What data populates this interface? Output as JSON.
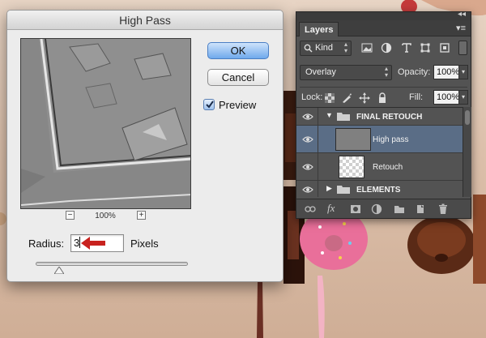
{
  "dialog": {
    "title": "High Pass",
    "ok_label": "OK",
    "cancel_label": "Cancel",
    "preview_label": "Preview",
    "preview_checked": true,
    "zoom_level": "100%",
    "radius_label": "Radius:",
    "radius_value": "3",
    "radius_units": "Pixels",
    "radius_slider_value": 3
  },
  "layers_panel": {
    "tab_label": "Layers",
    "filter_kind": "Kind",
    "blend_mode": "Overlay",
    "opacity_label": "Opacity:",
    "opacity_value": "100%",
    "lock_label": "Lock:",
    "fill_label": "Fill:",
    "fill_value": "100%",
    "layers": [
      {
        "name": "FINAL RETOUCH",
        "type": "group",
        "expanded": true,
        "visible": true
      },
      {
        "name": "High pass",
        "type": "layer",
        "selected": true,
        "visible": true,
        "thumbnail": "gray"
      },
      {
        "name": "Retouch",
        "type": "layer",
        "selected": false,
        "visible": true,
        "thumbnail": "transparent"
      },
      {
        "name": "ELEMENTS",
        "type": "group",
        "expanded": false,
        "visible": true
      }
    ],
    "filter_icons": [
      "image-filter-icon",
      "adjustment-filter-icon",
      "type-filter-icon",
      "shape-filter-icon",
      "smart-object-filter-icon"
    ],
    "lock_icons": [
      "lock-transparent-icon",
      "lock-image-icon",
      "lock-position-icon",
      "lock-all-icon"
    ],
    "footer_icons": [
      "link-layers-icon",
      "fx-icon",
      "add-mask-icon",
      "adjustment-layer-icon",
      "new-group-icon",
      "new-layer-icon",
      "delete-icon"
    ]
  },
  "colors": {
    "ok_button": "#6fa9ec",
    "panel_bg": "#535353",
    "selected_layer": "#5a6d86",
    "arrow": "#c8221f"
  }
}
